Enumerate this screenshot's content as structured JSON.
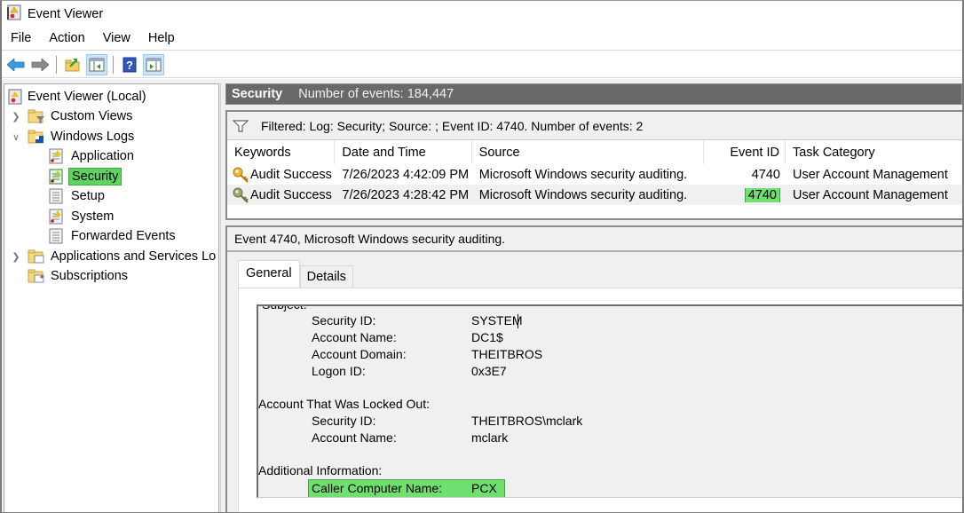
{
  "window": {
    "title": "Event Viewer"
  },
  "menu": [
    "File",
    "Action",
    "View",
    "Help"
  ],
  "toolbar": {
    "buttons": [
      "back-icon",
      "forward-icon",
      "up-folder-icon",
      "show-hide-tree-icon",
      "help-icon",
      "show-hide-action-pane-icon"
    ]
  },
  "tree": {
    "root": "Event Viewer (Local)",
    "items": [
      {
        "label": "Custom Views",
        "expanded": false
      },
      {
        "label": "Windows Logs",
        "expanded": true
      },
      {
        "label": "Application"
      },
      {
        "label": "Security",
        "selected": true
      },
      {
        "label": "Setup"
      },
      {
        "label": "System"
      },
      {
        "label": "Forwarded Events"
      },
      {
        "label": "Applications and Services Lo",
        "expanded": false
      },
      {
        "label": "Subscriptions"
      }
    ]
  },
  "log_header": {
    "name": "Security",
    "count": "Number of events: 184,447"
  },
  "filter": {
    "text": "Filtered: Log: Security; Source: ; Event ID: 4740. Number of events: 2"
  },
  "grid": {
    "columns": [
      "Keywords",
      "Date and Time",
      "Source",
      "Event ID",
      "Task Category"
    ],
    "rows": [
      {
        "keywords": "Audit Success",
        "datetime": "7/26/2023 4:42:09 PM",
        "source": "Microsoft Windows security auditing.",
        "event_id": "4740",
        "task": "User Account Management"
      },
      {
        "keywords": "Audit Success",
        "datetime": "7/26/2023 4:28:42 PM",
        "source": "Microsoft Windows security auditing.",
        "event_id": "4740",
        "task": "User Account Management",
        "selected": true
      }
    ]
  },
  "details": {
    "title": "Event 4740, Microsoft Windows security auditing.",
    "tabs": [
      "General",
      "Details"
    ],
    "active_tab": "General",
    "partial_heading": "Subject:",
    "subject": [
      {
        "k": "Security ID:",
        "v": "SYSTEM"
      },
      {
        "k": "Account Name:",
        "v": "DC1$"
      },
      {
        "k": "Account Domain:",
        "v": "THEITBROS"
      },
      {
        "k": "Logon ID:",
        "v": "0x3E7"
      }
    ],
    "locked_heading": "Account That Was Locked Out:",
    "locked": [
      {
        "k": "Security ID:",
        "v": "THEITBROS\\mclark"
      },
      {
        "k": "Account Name:",
        "v": "mclark"
      }
    ],
    "additional_heading": "Additional Information:",
    "additional": [
      {
        "k": "Caller Computer Name:",
        "v": "PCX"
      }
    ]
  },
  "colors": {
    "highlight": "#6fe06f",
    "header_bg": "#696969"
  }
}
